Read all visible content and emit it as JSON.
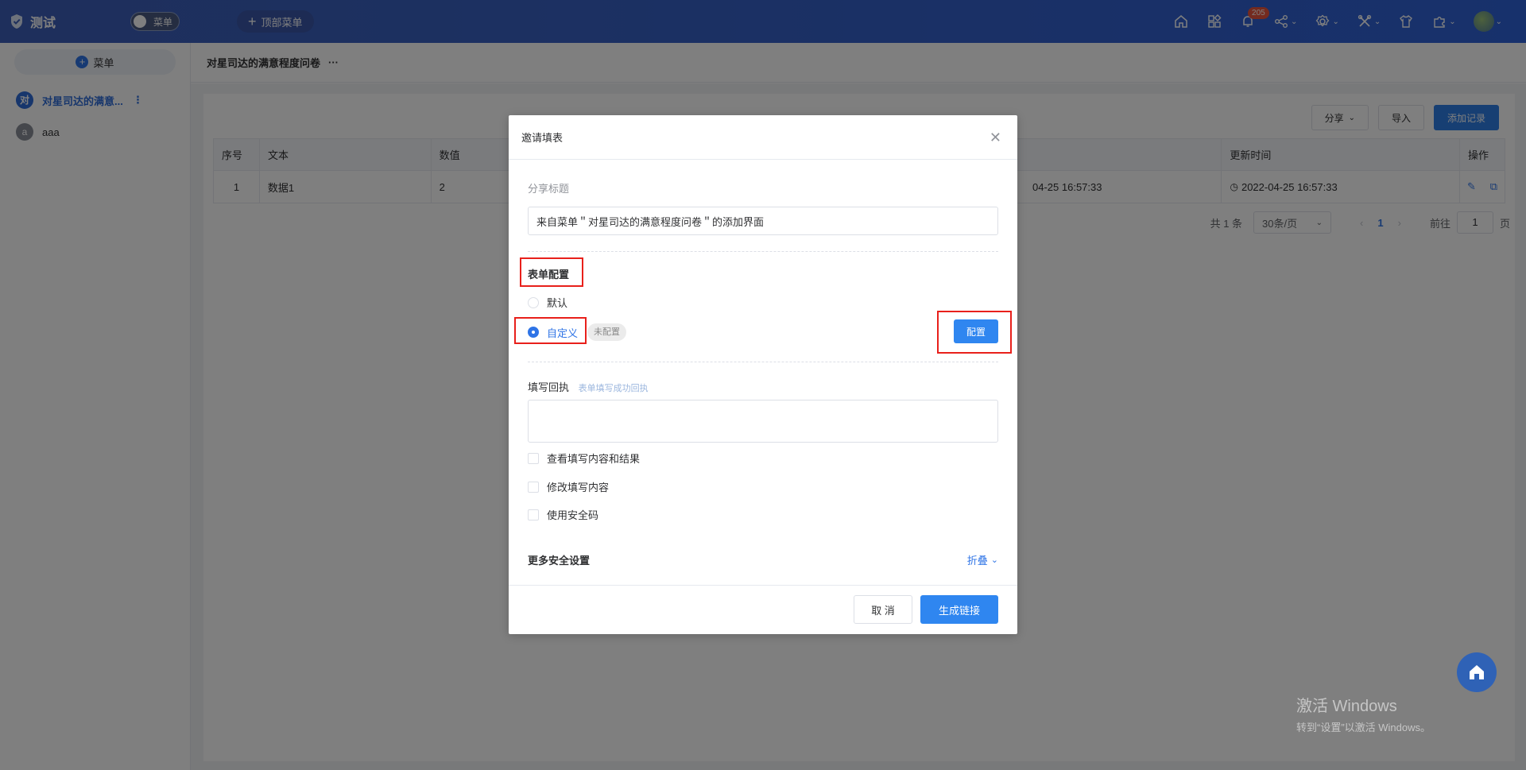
{
  "app": {
    "title": "测试"
  },
  "topbar": {
    "menu_toggle_label": "菜单",
    "top_menu_label": "顶部菜单",
    "notification_count": "205"
  },
  "sidebar": {
    "add_menu_label": "菜单",
    "items": [
      {
        "avatar": "对",
        "label": "对星司达的满意...",
        "active": true,
        "color": "#2f6cd9"
      },
      {
        "avatar": "a",
        "label": "aaa",
        "active": false,
        "color": "#8a8f99"
      }
    ]
  },
  "breadcrumb": {
    "title": "对星司达的满意程度问卷",
    "more": "···"
  },
  "toolbar": {
    "share_label": "分享",
    "import_label": "导入",
    "add_record_label": "添加记录"
  },
  "table": {
    "columns": [
      "序号",
      "文本",
      "数值",
      "更新时间",
      "操作"
    ],
    "rows": [
      {
        "index": "1",
        "text": "数据1",
        "value": "2",
        "created_partial": "04-25 16:57:33",
        "updated": "2022-04-25 16:57:33"
      }
    ]
  },
  "pagination": {
    "total": "共 1 条",
    "page_size": "30条/页",
    "current_page": "1",
    "goto_label": "前往",
    "goto_value": "1",
    "page_unit": "页"
  },
  "dialog": {
    "title": "邀请填表",
    "share_title_label": "分享标题",
    "share_title_value": "来自菜单＂对星司达的满意程度问卷＂的添加界面",
    "form_config_title": "表单配置",
    "radio_default": "默认",
    "radio_custom": "自定义",
    "custom_tag": "未配置",
    "config_button": "配置",
    "receipt_label": "填写回执",
    "receipt_hint": "表单填写成功回执",
    "checkbox_view": "查看填写内容和结果",
    "checkbox_modify": "修改填写内容",
    "checkbox_security": "使用安全码",
    "more_security": "更多安全设置",
    "fold_label": "折叠",
    "cancel_label": "取 消",
    "generate_label": "生成链接"
  },
  "watermark": {
    "line1": "激活 Windows",
    "line2": "转到“设置”以激活 Windows。"
  }
}
